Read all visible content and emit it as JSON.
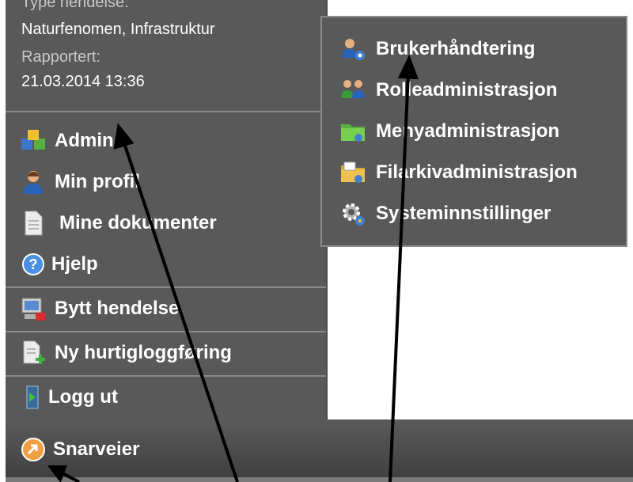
{
  "info": {
    "type_label": "Type hendelse:",
    "type_value": "Naturfenomen, Infrastruktur",
    "reported_label": "Rapportert:",
    "reported_value": "21.03.2014 13:36"
  },
  "menu": {
    "items": [
      {
        "label": "Admin",
        "icon": "admin-icon"
      },
      {
        "label": "Min profil",
        "icon": "user-icon"
      },
      {
        "label": "Mine dokumenter",
        "icon": "document-icon"
      },
      {
        "label": "Hjelp",
        "icon": "help-icon"
      },
      {
        "label": "Bytt hendelse",
        "icon": "switch-event-icon"
      },
      {
        "label": "Ny hurtigloggføring",
        "icon": "new-log-icon"
      },
      {
        "label": "Logg ut",
        "icon": "logout-icon"
      }
    ]
  },
  "submenu": {
    "items": [
      {
        "label": "Brukerhåndtering",
        "icon": "users-icon"
      },
      {
        "label": "Rolleadministrasjon",
        "icon": "roles-icon"
      },
      {
        "label": "Menyadministrasjon",
        "icon": "menu-folder-icon"
      },
      {
        "label": "Filarkivadministrasjon",
        "icon": "file-archive-icon"
      },
      {
        "label": "Systeminnstillinger",
        "icon": "gear-icon"
      }
    ]
  },
  "bottom": {
    "snarveier_label": "Snarveier"
  },
  "colors": {
    "panel": "#595959",
    "separator": "#8a8a8a",
    "text": "#ffffff",
    "arrow": "#000000"
  }
}
